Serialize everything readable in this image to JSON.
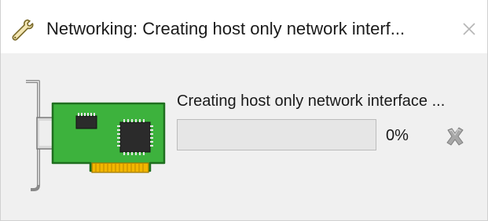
{
  "window": {
    "title": "Networking: Creating host only network interf...",
    "title_icon": "wrench-icon",
    "close_icon": "close-icon"
  },
  "main": {
    "image_icon": "network-card-icon",
    "status_text": "Creating host only network interface ...",
    "progress": {
      "value": 0,
      "label": "0%"
    },
    "cancel_icon": "cancel-icon"
  },
  "colors": {
    "titlebar_bg": "#ffffff",
    "body_bg": "#f0f0f0",
    "progress_track": "#e6e6e6",
    "progress_fill": "#06b025",
    "card_green": "#3db23d",
    "card_gold": "#f2b600"
  }
}
